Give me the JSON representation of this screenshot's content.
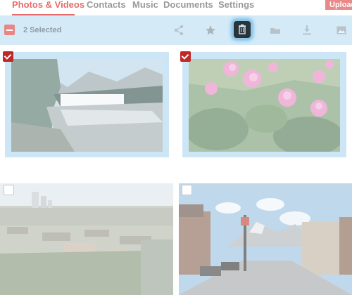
{
  "tabs": [
    {
      "label": "Photos & Videos",
      "active": true
    },
    {
      "label": "Contacts",
      "active": false
    },
    {
      "label": "Music",
      "active": false
    },
    {
      "label": "Documents",
      "active": false
    },
    {
      "label": "Settings",
      "active": false
    }
  ],
  "upload_label": "Upload",
  "selection": {
    "count_text": "2 Selected"
  },
  "actions": [
    "share-icon",
    "star-icon",
    "trash-icon",
    "folder-icon",
    "download-icon",
    "image-icon"
  ],
  "photos": [
    {
      "subject": "waterfall-river",
      "selected": true
    },
    {
      "subject": "pink-flowers",
      "selected": true
    },
    {
      "subject": "city-aerial",
      "selected": false
    },
    {
      "subject": "mountain-street",
      "selected": false
    }
  ],
  "colors": {
    "accent": "#e86b6b",
    "action_bar": "#d4eaf6",
    "checkbox_on": "#c02828"
  }
}
